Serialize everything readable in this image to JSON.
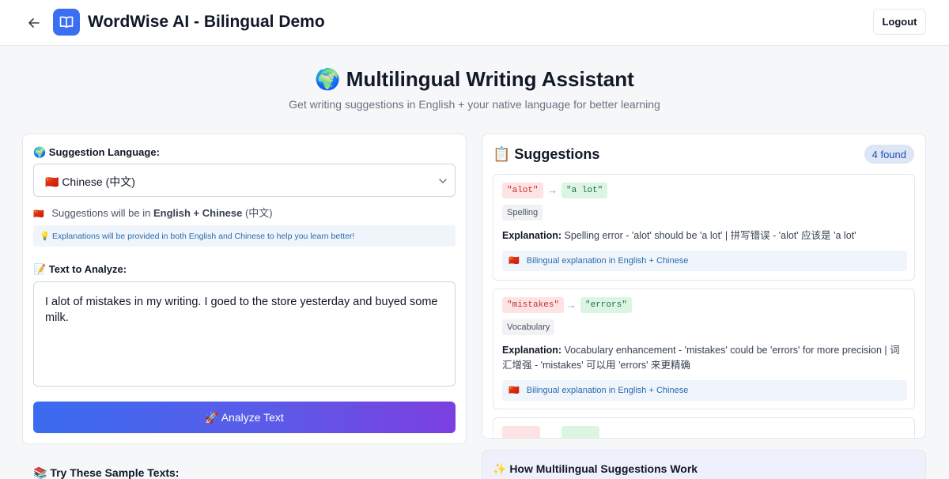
{
  "header": {
    "app_title": "WordWise AI - Bilingual Demo",
    "logout_label": "Logout",
    "icons": {
      "back": "arrow-left-icon",
      "logo": "book-open-icon"
    }
  },
  "hero": {
    "title": "🌍 Multilingual Writing Assistant",
    "subtitle": "Get writing suggestions in English + your native language for better learning"
  },
  "left": {
    "language_label": "🌍 Suggestion Language:",
    "language_selected": "🇨🇳 Chinese (中文)",
    "language_note_prefix": "Suggestions will be in",
    "language_note_bold": "English + Chinese",
    "language_note_suffix": "(中文)",
    "info_text": "💡 Explanations will be provided in both English and Chinese to help you learn better!",
    "text_label": "📝 Text to Analyze:",
    "text_value": "I alot of mistakes in my writing. I goed to the store yesterday and buyed some milk.",
    "analyze_label": "🚀 Analyze Text"
  },
  "right": {
    "title": "📋 Suggestions",
    "count": "4 found",
    "suggestions": [
      {
        "original": "\"alot\"",
        "replacement": "\"a lot\"",
        "type": "Spelling",
        "explanation_label": "Explanation:",
        "explanation": "Spelling error - 'alot' should be 'a lot' | 拼写错误 - 'alot' 应该是 'a lot'",
        "bilingual_note": "Bilingual explanation in English + Chinese"
      },
      {
        "original": "\"mistakes\"",
        "replacement": "\"errors\"",
        "type": "Vocabulary",
        "explanation_label": "Explanation:",
        "explanation": "Vocabulary enhancement - 'mistakes' could be 'errors' for more precision | 词汇增强 - 'mistakes' 可以用 'errors' 来更精确",
        "bilingual_note": "Bilingual explanation in English + Chinese"
      }
    ]
  },
  "bottom": {
    "sample_title": "📚 Try These Sample Texts:",
    "how_title": "✨  How Multilingual Suggestions Work"
  },
  "colors": {
    "accent": "#3b6ff2",
    "gradient_start": "#3a6cf0",
    "gradient_end": "#7c3fe0",
    "error_bg": "#fde3e3",
    "fix_bg": "#dcf5e3"
  }
}
